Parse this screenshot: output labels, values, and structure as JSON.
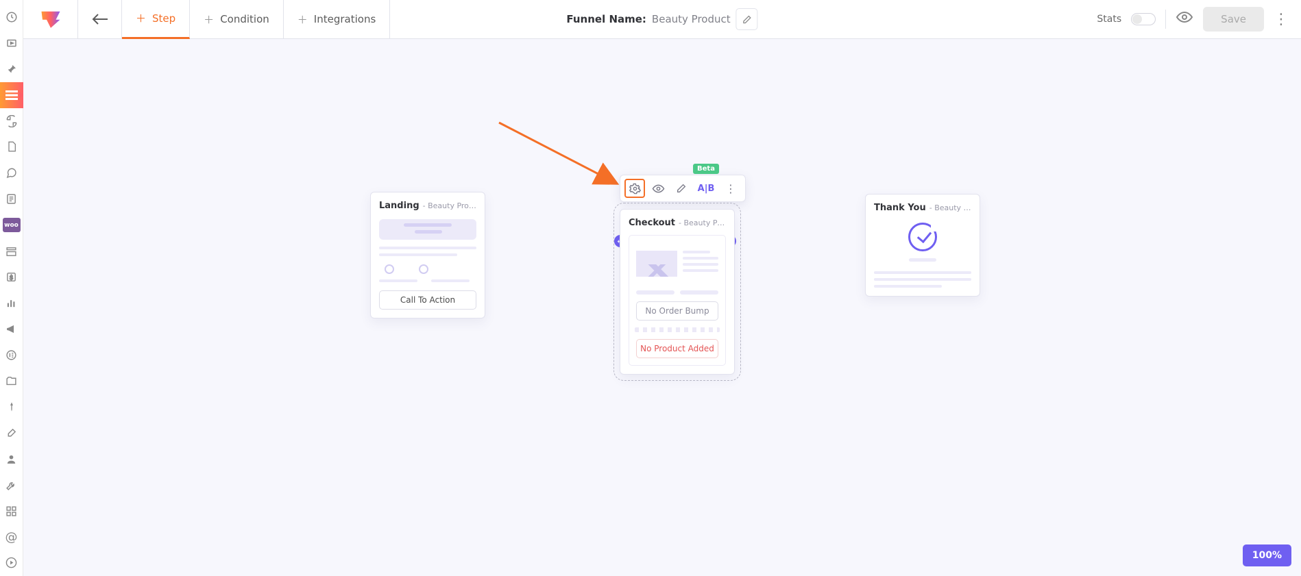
{
  "sidebar": {
    "active_index": 3,
    "woo_label": "woo"
  },
  "topbar": {
    "tabs": [
      {
        "label": "Step"
      },
      {
        "label": "Condition"
      },
      {
        "label": "Integrations"
      }
    ],
    "funnel_name_label": "Funnel Name:",
    "funnel_name": "Beauty Product",
    "stats_label": "Stats",
    "save_label": "Save"
  },
  "toolbar": {
    "ab_label": "A|B",
    "beta_badge": "Beta"
  },
  "nodes": {
    "landing": {
      "title": "Landing",
      "subtitle": "- Beauty Produc...",
      "cta": "Call To Action"
    },
    "checkout": {
      "title": "Checkout",
      "subtitle": "- Beauty Produc...",
      "order_bump": "No Order Bump",
      "no_product": "No Product Added"
    },
    "thankyou": {
      "title": "Thank You",
      "subtitle": "- Beauty Produc..."
    }
  },
  "zoom": "100%"
}
